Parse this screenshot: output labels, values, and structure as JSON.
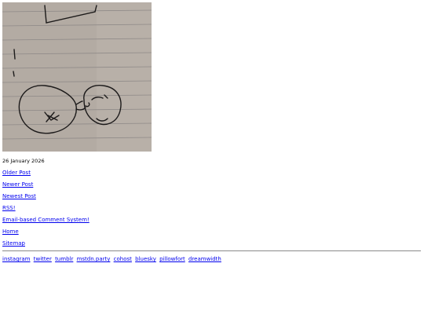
{
  "photo": {
    "subject": "pencil sketch on lined notebook paper"
  },
  "post": {
    "date": "26 January 2026"
  },
  "nav": {
    "older": "Older Post",
    "newer": "Newer Post",
    "newest": "Newest Post",
    "rss": "RSS!",
    "comments": "Email-based Comment System!",
    "home": "Home",
    "sitemap": "Sitemap"
  },
  "social": [
    "instagram",
    "twitter",
    "tumblr",
    "mstdn.party",
    "cohost",
    "bluesky",
    "pillowfort",
    "dreamwidth"
  ],
  "colors": {
    "link": "#0000ee",
    "paper": "#b4aca4"
  }
}
